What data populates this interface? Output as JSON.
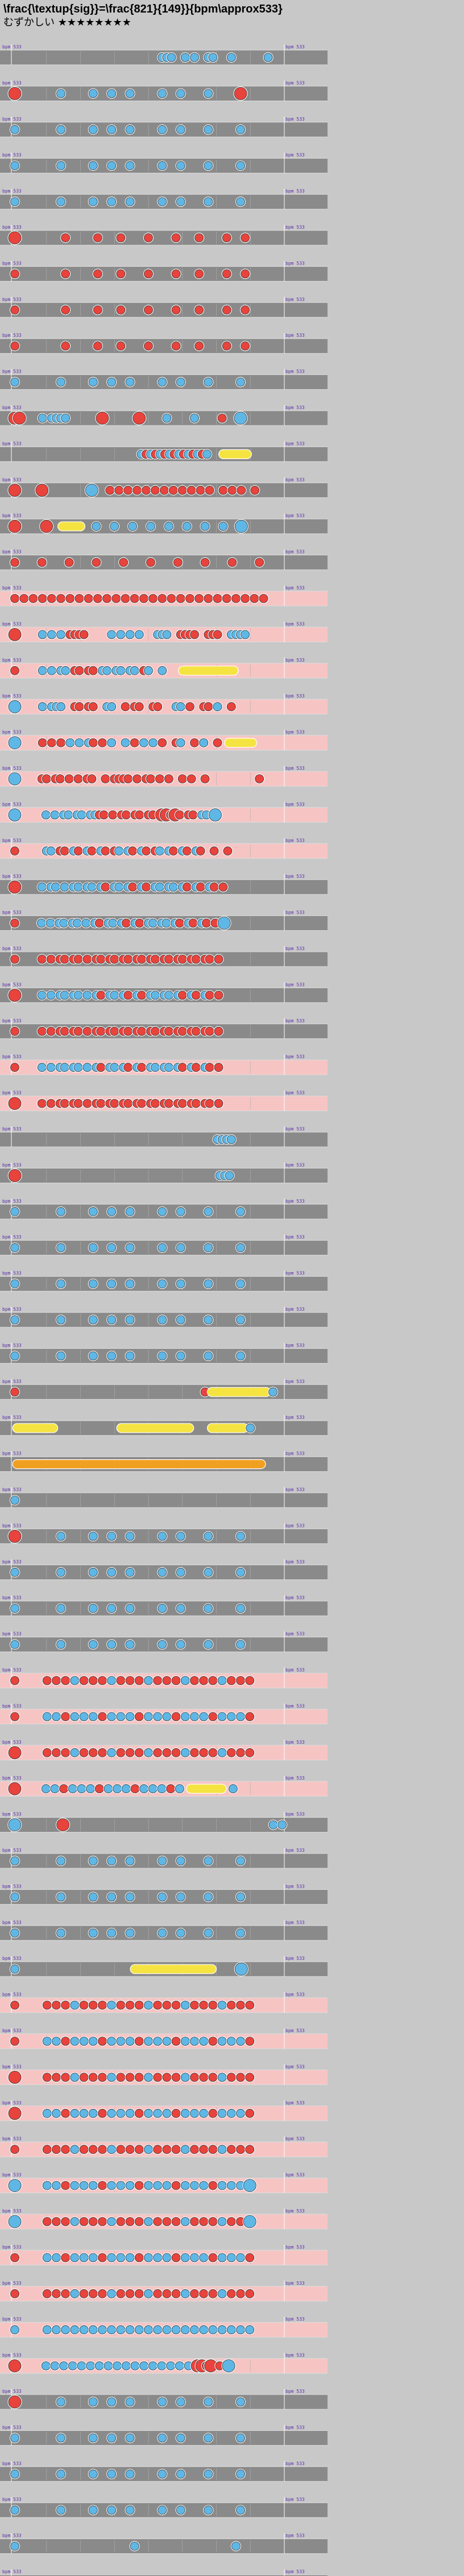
{
  "title": "\\frac{\\textup{sig}}=\\frac{821}{149}}{bpm\\approx533}",
  "difficulty": {
    "label": "むずかしい",
    "stars": "★★★★★★★★"
  },
  "bpm_label": "bpm 533",
  "measure_count": 71,
  "rows": [
    {
      "n": 1,
      "bg": "gray",
      "notes": "................................kkk..k.k..kk...k.......k..."
    },
    {
      "n": 2,
      "bg": "gray",
      "notes": "D.........k......k...k...k......k...k.....k......D........."
    },
    {
      "n": 3,
      "bg": "gray",
      "notes": "k.........k......k...k...k......k...k.....k......k........."
    },
    {
      "n": 4,
      "bg": "gray",
      "notes": "k.........k......k...k...k......k...k.....k......k........."
    },
    {
      "n": 5,
      "bg": "gray",
      "notes": "k.........k......k...k...k......k...k.....k......k........."
    },
    {
      "n": 6,
      "bg": "gray",
      "notes": "D..........d......d....d.....d.....d....d.....d...d........"
    },
    {
      "n": 7,
      "bg": "gray",
      "notes": "d..........d......d....d.....d.....d....d.....d...d........"
    },
    {
      "n": 8,
      "bg": "gray",
      "notes": "d..........d......d....d.....d.....d....d.....d...d........"
    },
    {
      "n": 9,
      "bg": "gray",
      "notes": "d..........d......d....d.....d.....d....d.....d...d........"
    },
    {
      "n": 10,
      "bg": "gray",
      "notes": "k.........k......k...k...k......k...k.....k......k........."
    },
    {
      "n": 11,
      "bg": "gray",
      "notes": "DD....k.kkkk.......D.......D.....k.....k.....d...K........."
    },
    {
      "n": 12,
      "bg": "gray",
      "notes": "...........................kdkdkdkdkdkdkdk..=======......."
    },
    {
      "n": 13,
      "bg": "gray",
      "notes": "D.....D..........K...d.d.d.d.d.d.d.d.d.d.d.d..d.d.d..d......"
    },
    {
      "n": 14,
      "bg": "gray",
      "notes": "D......D..======..k...k...k...k...k...k...k...k...K........."
    },
    {
      "n": 15,
      "bg": "gray",
      "notes": "d.....d.....d.....d.....d.....d.....d.....d.....d.....d....."
    },
    {
      "n": 16,
      "bg": "pink",
      "notes": "d.d.d.d.d.d.d.d.d.d.d.d.d.d.d.d.d.d.d.d.d.d.d.d.d.d.d.d...."
    },
    {
      "n": 17,
      "bg": "pink",
      "notes": "D.....k.k.k.dddd.....k.k.k.k...kkk..dddd..ddd..kkkk........"
    },
    {
      "n": 18,
      "bg": "pink",
      "notes": "d.....k.k.kk.dd.dd.kk.kk.kk.dk..k...=============.........."
    },
    {
      "n": 19,
      "bg": "pink",
      "notes": "K.....k.kkk..dd.dd..kk..d.dd..dd...kk.d..dd.k..d..........."
    },
    {
      "n": 20,
      "bg": "pink",
      "notes": "K.....d.d.d.k.k.kd.d.k..k.d.k.k.d..dk..d.k..d.=======......"
    },
    {
      "n": 21,
      "bg": "pink",
      "notes": "K.....dd.dd.d.d.dd..d.dddd.d.dd.d.d..d.d..d...........d....."
    },
    {
      "n": 22,
      "bg": "pink",
      "notes": "K......k.k.kk.kk.kkdd.d.dd.dd.dd.DDdDd.dd.kk.K..............."
    },
    {
      "n": 23,
      "bg": "pink",
      "notes": "d......kk.dd.kd.kd.kd.dk.kd.kd.dk.kd.kd.kd..d..d............"
    },
    {
      "n": 24,
      "bg": "gray",
      "notes": "D.....k.kk.k.kk.kk.kd.kk.kd.kd.kk.kk.kd.kd.kd.d............."
    },
    {
      "n": 25,
      "bg": "gray",
      "notes": "d.....k.k.kk.kk.k.kd.kk.kd.kd.kk.kk.kd.kd.kd.d.K............."
    },
    {
      "n": 26,
      "bg": "gray",
      "notes": "d.....d.d.dd.dd.d.dd.dd.dd.dd.dd.dd.dd.dd.dd.d.............."
    },
    {
      "n": 27,
      "bg": "gray",
      "notes": "D.....k.k.kk.kk.k.kd.kk.kd.kd.kk.kk.kd.kd.kd.d.............."
    },
    {
      "n": 28,
      "bg": "gray",
      "notes": "d.....d.d.dd.dd.d.dd.dd.dd.dd.dd.dd.dd.dd.dd.d.............."
    },
    {
      "n": 29,
      "bg": "pink",
      "notes": "d.....k.k.kk.kk.k.kd.kk.kd.kd.kk.kk.kd.kd.kd.d.............."
    },
    {
      "n": 30,
      "bg": "pink",
      "notes": "D.....d.d.dd.dd.d.dd.dd.dd.dd.dd.dd.dd.dd.dd.d.............."
    },
    {
      "n": 31,
      "bg": "gray",
      "notes": "............................................kkkk..........."
    },
    {
      "n": 32,
      "bg": "gray",
      "notes": "D..........................................kkk..........."
    },
    {
      "n": 33,
      "bg": "gray",
      "notes": "k.........k......k...k...k......k...k.....k......k........."
    },
    {
      "n": 34,
      "bg": "gray",
      "notes": "k.........k......k...k...k......k...k.....k......k........."
    },
    {
      "n": 35,
      "bg": "gray",
      "notes": "k.........k......k...k...k......k...k.....k......k........."
    },
    {
      "n": 36,
      "bg": "gray",
      "notes": "k.........k......k...k...k......k...k.....k......k........."
    },
    {
      "n": 37,
      "bg": "gray",
      "notes": "k.........k......k...k...k......k...k.....k......k........."
    },
    {
      "n": 38,
      "bg": "gray",
      "notes": "d.........................................d==============k.."
    },
    {
      "n": 39,
      "bg": "gray",
      "notes": "==========.............=================...=========k......."
    },
    {
      "n": 40,
      "bg": "gray",
      "notes": "######################################################...."
    },
    {
      "n": 41,
      "bg": "gray",
      "notes": "k.........................................................."
    },
    {
      "n": 42,
      "bg": "gray",
      "notes": "D.........k......k...k...k......k...k.....k......k........."
    },
    {
      "n": 43,
      "bg": "gray",
      "notes": "k.........k......k...k...k......k...k.....k......k........."
    },
    {
      "n": 44,
      "bg": "gray",
      "notes": "k.........k......k...k...k......k...k.....k......k........."
    },
    {
      "n": 45,
      "bg": "gray",
      "notes": "k.........k......k...k...k......k...k.....k......k........."
    },
    {
      "n": 46,
      "bg": "pink",
      "notes": "d......d.d.d.k.d.d.d.k.d.d.d.k.d.d.d.k.d.d.d.k.d.d.d......."
    },
    {
      "n": 47,
      "bg": "pink",
      "notes": "d......k.k.d.k.k.k.d.k.k.k.d.k.k.k.d.k.k.k.d.k.k.k.d......."
    },
    {
      "n": 48,
      "bg": "pink",
      "notes": "D......d.d.d.k.d.d.d.k.d.d.d.k.d.d.d.k.d.d.d.k.d.d.d......."
    },
    {
      "n": 49,
      "bg": "pink",
      "notes": "D......k.k.d.k.k.k.d.k.k.k.d.k.k.k.d.k.=========.k..........."
    },
    {
      "n": 50,
      "bg": "gray",
      "notes": "K..........D...............................................k.k"
    },
    {
      "n": 51,
      "bg": "gray",
      "notes": "k.........k......k...k...k......k...k.....k......k........."
    },
    {
      "n": 52,
      "bg": "gray",
      "notes": "k.........k......k...k...k......k...k.....k......k........."
    },
    {
      "n": 53,
      "bg": "gray",
      "notes": "k.........k......k...k...k......k...k.....k......k........."
    },
    {
      "n": 54,
      "bg": "gray",
      "notes": "k.........................===================.....K........."
    },
    {
      "n": 55,
      "bg": "pink",
      "notes": "d......d.d.d.k.d.d.d.k.d.d.d.k.d.d.d.k.d.d.d.k.d.d.d......."
    },
    {
      "n": 56,
      "bg": "pink",
      "notes": "d......k.k.d.k.k.k.d.k.k.k.d.k.k.k.d.k.k.k.d.k.k.k.d......."
    },
    {
      "n": 57,
      "bg": "pink",
      "notes": "D......d.d.d.k.d.d.d.k.d.d.d.k.d.d.d.k.d.d.d.k.d.d.d......."
    },
    {
      "n": 58,
      "bg": "pink",
      "notes": "D......k.k.d.k.k.k.d.k.k.k.d.k.k.k.d.k.k.k.d.k.k.k.d......."
    },
    {
      "n": 59,
      "bg": "pink",
      "notes": "d......d.d.d.k.d.d.d.k.d.d.d.k.d.d.d.k.d.d.d.k.d.d.d......."
    },
    {
      "n": 60,
      "bg": "pink",
      "notes": "K......k.k.d.k.k.k.d.k.k.k.d.k.k.k.d.k.k.k.d.k.k.k.K......."
    },
    {
      "n": 61,
      "bg": "pink",
      "notes": "K......d.d.d.k.d.d.d.k.d.d.d.k.d.d.d.k.d.d.d.k.d.d.K......."
    },
    {
      "n": 62,
      "bg": "pink",
      "notes": "d......k.k.d.k.k.k.d.k.k.k.d.k.k.k.d.k.k.k.d.k.k.k.d......."
    },
    {
      "n": 63,
      "bg": "pink",
      "notes": "d......d.d.d.k.d.d.d.k.d.d.d.k.d.d.d.k.d.d.d.k.d.d.d......."
    },
    {
      "n": 64,
      "bg": "pink",
      "notes": "k......k.k.k.k.k.k.k.k.k.k.k.k.k.k.k.k.k.k.k.k.k.k.k......."
    },
    {
      "n": 65,
      "bg": "pink",
      "notes": "D......k.k.k.k.k.k.k.k.k.k.k.k.k.k.k.k.k.DDdD.d.K............"
    },
    {
      "n": 66,
      "bg": "gray",
      "notes": "D.........k......k...k...k......k...k.....k......k........."
    },
    {
      "n": 67,
      "bg": "gray",
      "notes": "k.........k......k...k...k......k...k.....k......k........."
    },
    {
      "n": 68,
      "bg": "gray",
      "notes": "k.........k......k...k...k......k...k.....k......k........."
    },
    {
      "n": 69,
      "bg": "gray",
      "notes": "k.........k......k...k...k......k...k.....k......k........."
    },
    {
      "n": 70,
      "bg": "gray",
      "notes": "k.........................k.....................k.........."
    },
    {
      "n": 71,
      "bg": "gray",
      "notes": "k.........................k........................k......."
    }
  ],
  "colors": {
    "don": "#e8433c",
    "ka": "#5fb7e6",
    "roll": "#f5e342",
    "balloon": "#f0a020",
    "lane_gray": "#8a8a8a",
    "lane_pink": "#f7c4c4",
    "measure_line": "#ffffff",
    "page_bg": "#c8c8c8",
    "label": "#5a2da8"
  }
}
